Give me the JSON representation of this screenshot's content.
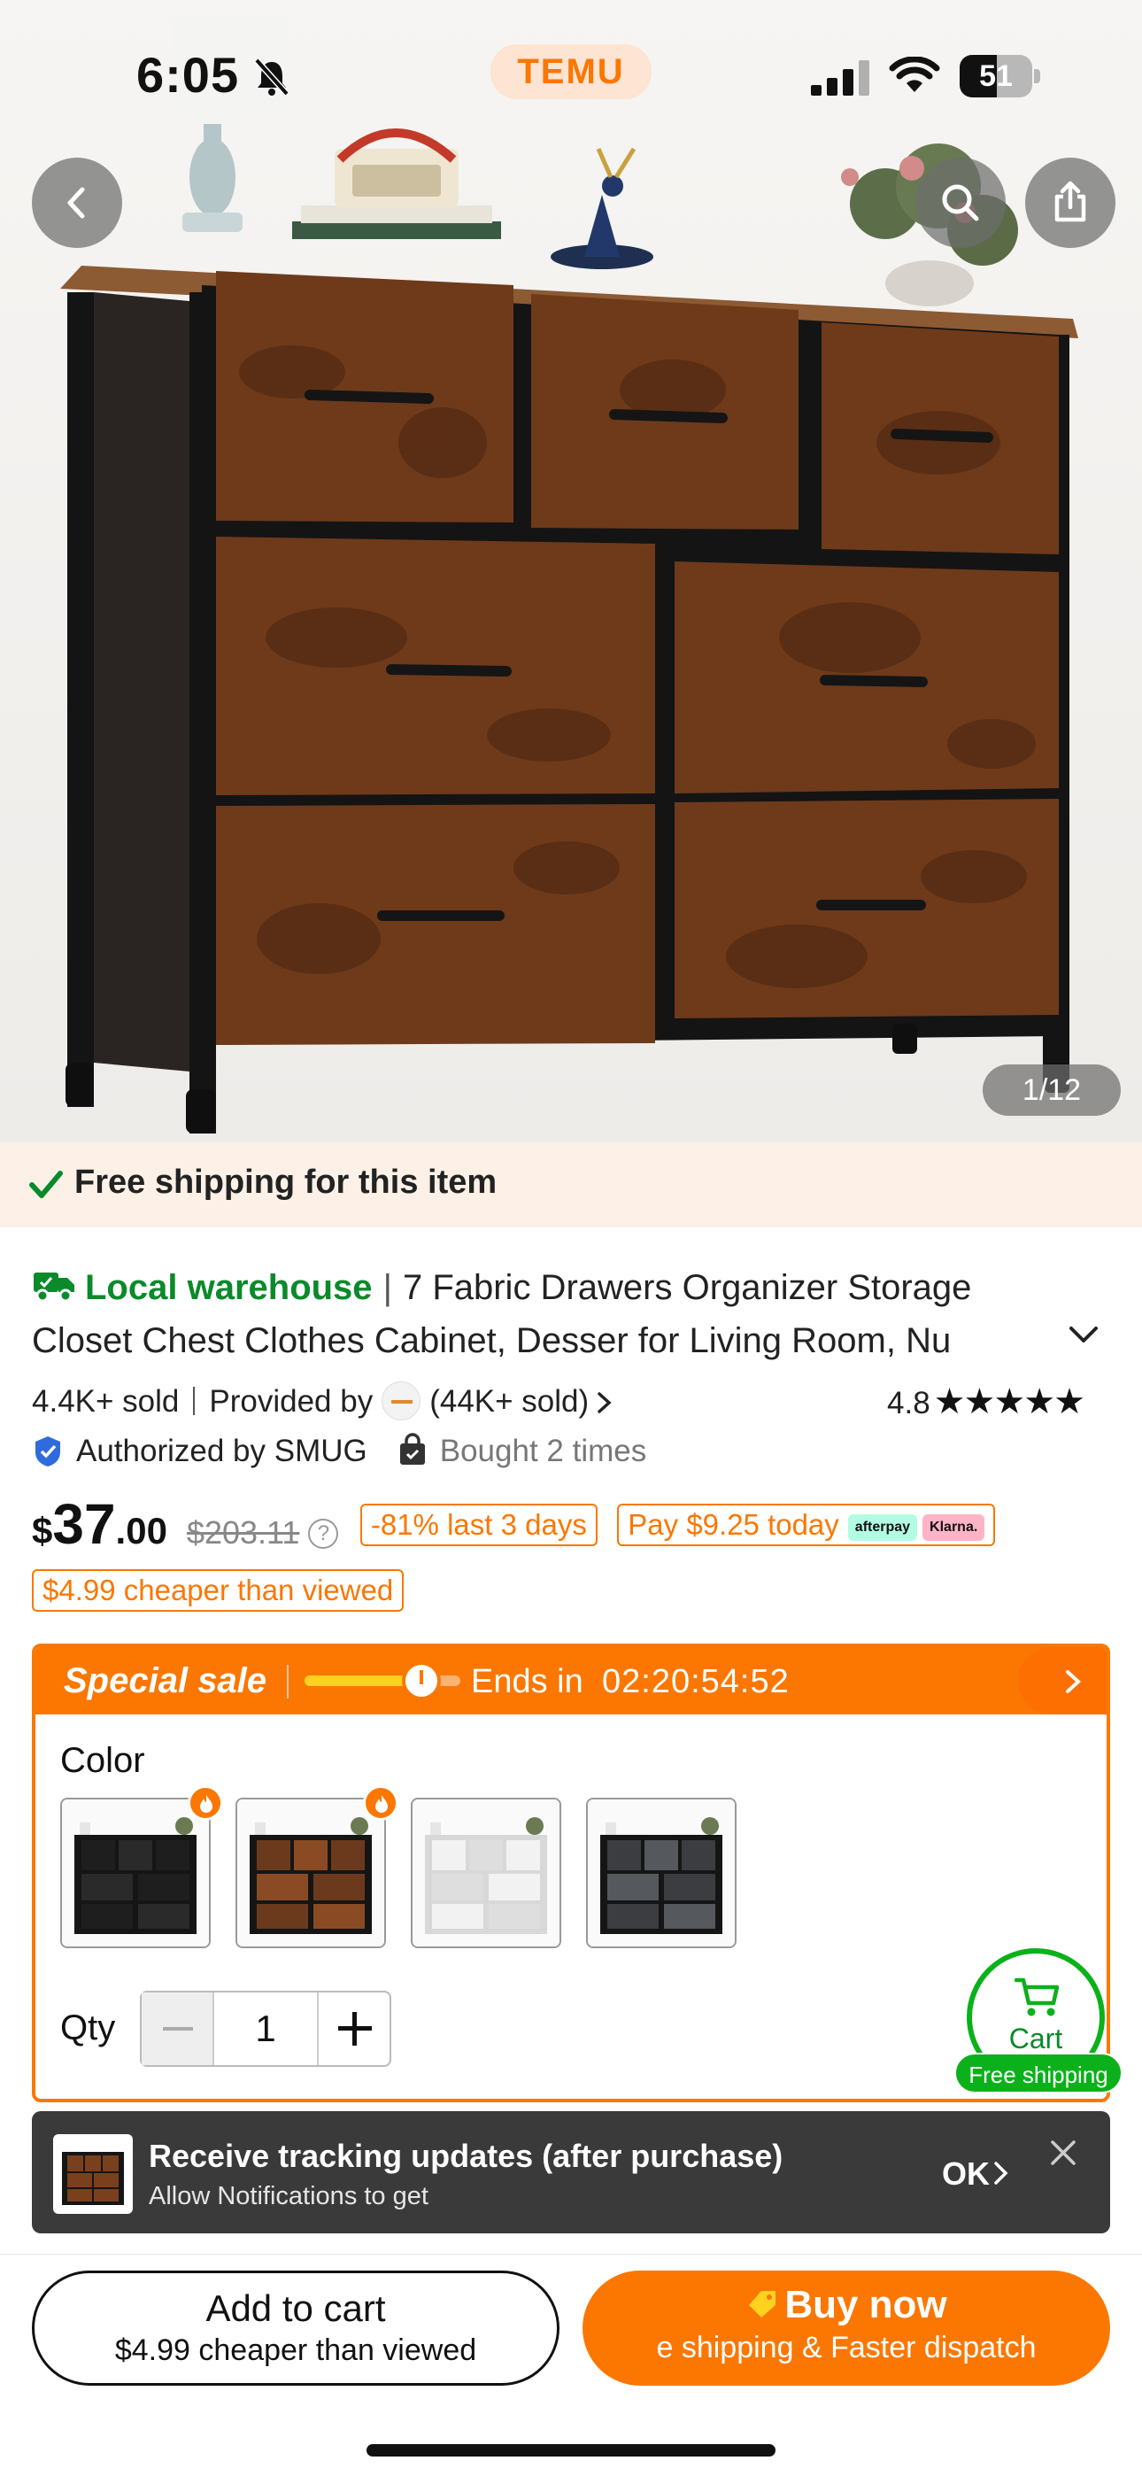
{
  "status_bar": {
    "time": "6:05",
    "battery_level": "51",
    "battery_fraction": 0.51
  },
  "app": {
    "logo_text": "TEMU",
    "brand_color": "#fb7701"
  },
  "hero": {
    "image_counter": "1/12",
    "icons": [
      "back-arrow-icon",
      "search-icon",
      "share-icon"
    ]
  },
  "shipping_banner": {
    "text": "Free shipping for this item"
  },
  "product": {
    "warehouse_label": "Local warehouse",
    "title_line1": "7 Fabric Drawers Organizer Storage",
    "title_line2": "Closet Chest Clothes Cabinet, Desser for Living Room, Nu",
    "sold": "4.4K+ sold",
    "provided_by": "Provided by",
    "store_sold": "(44K+ sold)",
    "rating": "4.8",
    "rating_stars": "★★★★★",
    "rating_value": 4.8,
    "authorized": "Authorized by SMUG",
    "bought": "Bought 2 times"
  },
  "price": {
    "currency": "$",
    "integer": "37",
    "decimal": ".00",
    "original": "$203.11",
    "discount_tag": "-81% last 3 days",
    "installment": "Pay $9.25 today",
    "afterpay_label": "afterpay",
    "klarna_label": "Klarna.",
    "cheaper_tag": "$4.99 cheaper than viewed"
  },
  "special_sale": {
    "title": "Special sale",
    "ends_label": "Ends in",
    "timer": "02:20:54:52",
    "progress": 0.85,
    "color_label": "Color",
    "swatches": [
      {
        "name": "Black",
        "hot": true,
        "colors": [
          "#1e1e1e",
          "#2a2a2a"
        ]
      },
      {
        "name": "Rustic Brown",
        "hot": true,
        "colors": [
          "#6b3a1c",
          "#8a4b24"
        ]
      },
      {
        "name": "White",
        "hot": false,
        "colors": [
          "#f2f2f2",
          "#dedede"
        ]
      },
      {
        "name": "Grey",
        "hot": false,
        "colors": [
          "#3b3d40",
          "#55585c"
        ]
      }
    ],
    "qty_label": "Qty",
    "qty_value": "1"
  },
  "floating_cart": {
    "label": "Cart",
    "badge": "Free shipping",
    "accent": "#0bb11a"
  },
  "toast": {
    "title": "Receive tracking updates (after purchase)",
    "subtitle": "Allow Notifications to get",
    "ok_label": "OK"
  },
  "bottom_bar": {
    "add_to_cart": "Add to cart",
    "add_to_cart_sub": "$4.99 cheaper than viewed",
    "buy_now": "Buy now",
    "buy_now_sub": "e shipping & Faster dispatch"
  }
}
